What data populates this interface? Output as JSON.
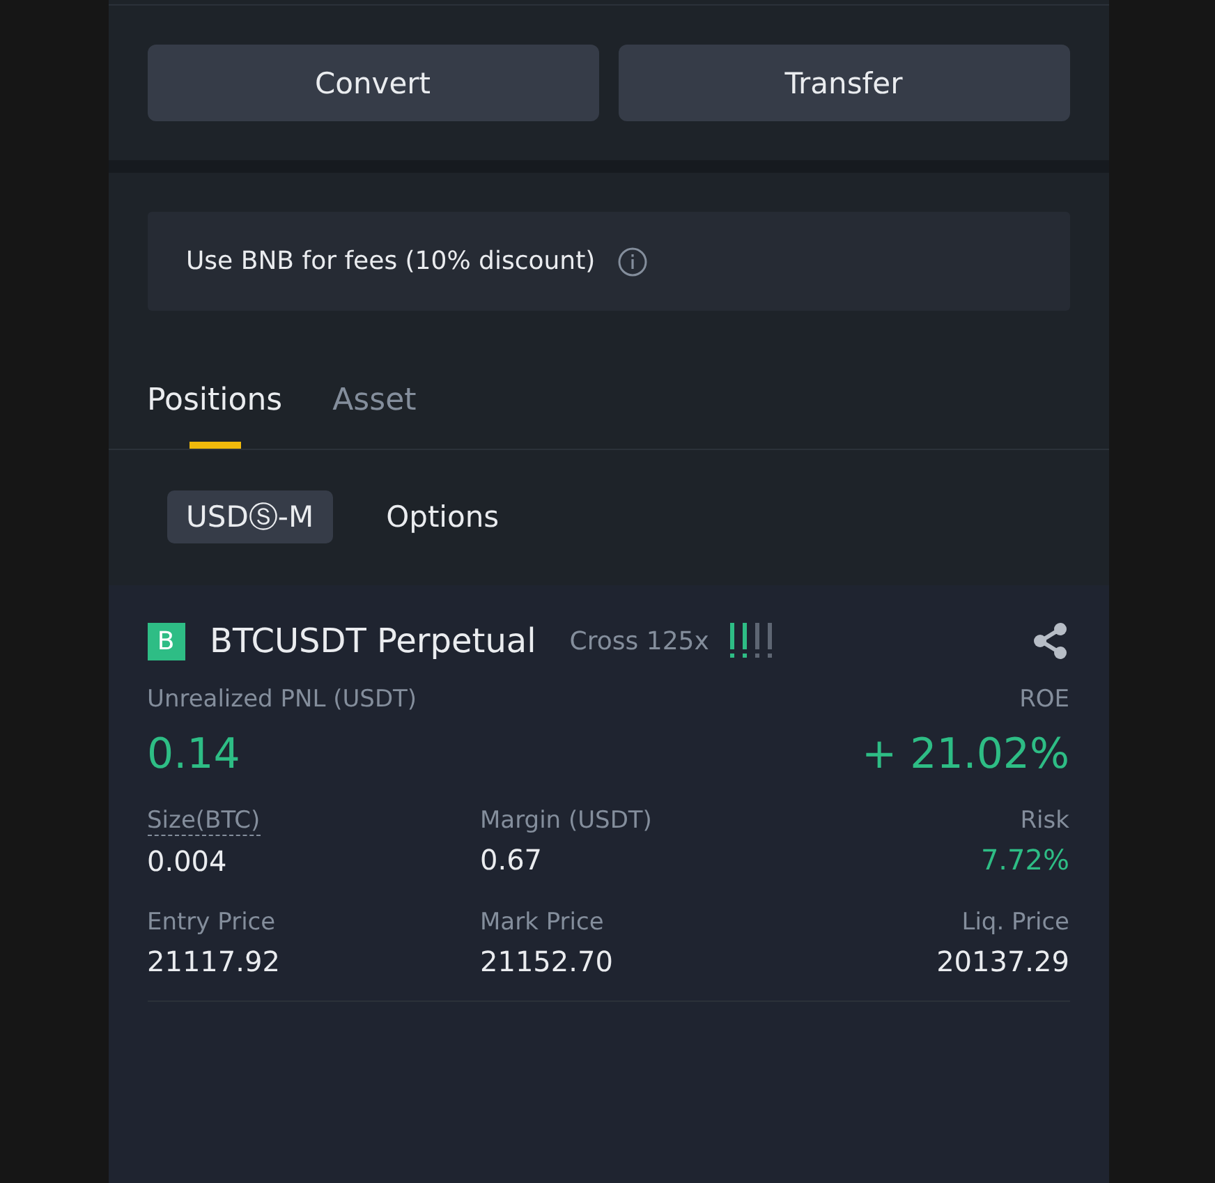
{
  "actions": [
    {
      "label": "Convert"
    },
    {
      "label": "Transfer"
    }
  ],
  "fee_notice": {
    "text": "Use BNB for fees (10% discount)"
  },
  "tabs": [
    {
      "label": "Positions",
      "selected": true
    },
    {
      "label": "Asset",
      "selected": false
    }
  ],
  "sub_tabs": [
    {
      "label": "USDⓈ-M",
      "selected": true
    },
    {
      "label": "Options",
      "selected": false
    }
  ],
  "position": {
    "side_badge": "B",
    "symbol": "BTCUSDT Perpetual",
    "margin_mode": "Cross 125x",
    "risk_meter": {
      "level": 0.5
    },
    "pnl": {
      "label": "Unrealized PNL (USDT)",
      "value": "0.14"
    },
    "roe": {
      "label": "ROE",
      "value": "+ 21.02%"
    },
    "fields": [
      {
        "label": "Size(BTC)",
        "value": "0.004",
        "dashed": true,
        "positive": false
      },
      {
        "label": "Margin (USDT)",
        "value": "0.67",
        "dashed": false,
        "positive": false
      },
      {
        "label": "Risk",
        "value": "7.72%",
        "dashed": false,
        "positive": true
      },
      {
        "label": "Entry Price",
        "value": "21117.92",
        "dashed": false,
        "positive": false
      },
      {
        "label": "Mark Price",
        "value": "21152.70",
        "dashed": false,
        "positive": false
      },
      {
        "label": "Liq. Price",
        "value": "20137.29",
        "dashed": false,
        "positive": false
      }
    ]
  }
}
